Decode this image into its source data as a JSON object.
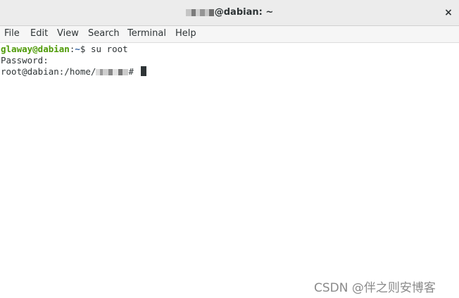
{
  "window": {
    "title_suffix": "@dabian: ~",
    "close_glyph": "×"
  },
  "menu": {
    "items": [
      "File",
      "Edit",
      "View",
      "Search",
      "Terminal",
      "Help"
    ]
  },
  "terminal": {
    "lines": [
      {
        "user_host": "glaway@dabian",
        "sep": ":",
        "path": "~",
        "prompt": "$ ",
        "command": "su root"
      },
      {
        "text": "Password:"
      },
      {
        "prefix": "root@dabian:/home/",
        "suffix": "# "
      }
    ]
  },
  "watermark": "CSDN @伴之则安博客",
  "colors": {
    "user_host": "#4e9a06",
    "path": "#3465a4",
    "text": "#2e3436"
  },
  "icons": {
    "close": "close-icon"
  }
}
